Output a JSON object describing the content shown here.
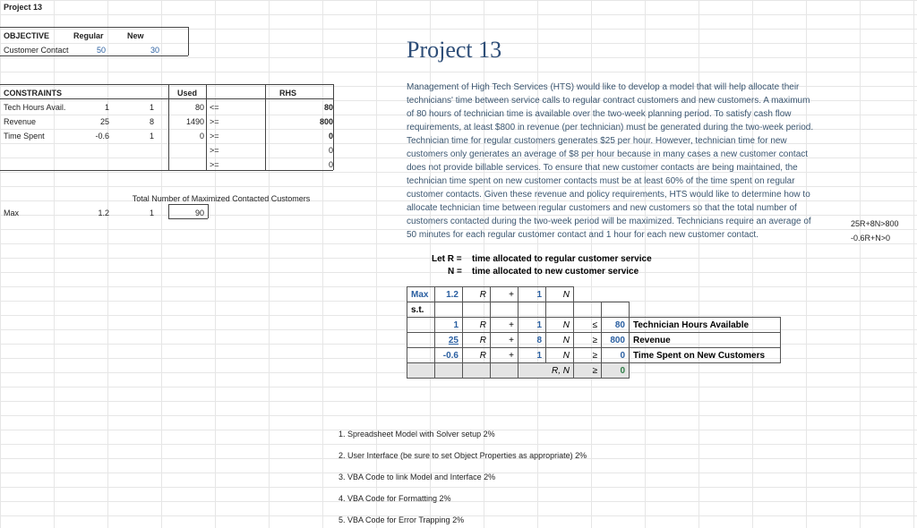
{
  "sheet_title": "Project 13",
  "objective": {
    "label": "OBJECTIVE",
    "row_label": "Customer Contact",
    "col_regular": "Regular",
    "col_new": "New",
    "regular": "50",
    "new_": "30"
  },
  "constraints": {
    "label": "CONSTRAINTS",
    "used_label": "Used",
    "rhs_label": "RHS",
    "rows": [
      {
        "name": "Tech Hours Avail.",
        "c1": "1",
        "c2": "1",
        "used": "80",
        "op": "<=",
        "rhs": "80"
      },
      {
        "name": "Revenue",
        "c1": "25",
        "c2": "8",
        "used": "1490",
        "op": ">=",
        "rhs": "800"
      },
      {
        "name": "Time Spent",
        "c1": "-0.6",
        "c2": "1",
        "used": "0",
        "op": ">=",
        "rhs": "0"
      },
      {
        "name": "",
        "c1": "",
        "c2": "",
        "used": "",
        "op": ">=",
        "rhs": "0"
      },
      {
        "name": "",
        "c1": "",
        "c2": "",
        "used": "",
        "op": ">=",
        "rhs": "0"
      }
    ],
    "total_label": "Total Number of Maximized Contacted Customers",
    "max_label": "Max",
    "max_c1": "1.2",
    "max_c2": "1",
    "max_total": "90"
  },
  "problem": {
    "title": "Project 13",
    "text": "Management of High Tech Services (HTS) would like to develop a model that will help allocate their technicians' time between service calls to regular contract customers and new customers. A maximum of 80 hours of technician time is available over the two-week planning period. To satisfy cash flow requirements, at least $800 in revenue (per technician) must be generated during the two-week period. Technician time for regular customers generates $25 per hour. However, technician time for new customers only generates an average of $8 per hour because in many cases a new customer contact does not provide billable services. To ensure that new customer contacts are being maintained, the technician time spent on new customer contacts must be at least 60% of the time spent on regular customer contacts. Given these revenue and policy requirements, HTS would like to determine how to allocate technician time between regular customers and new customers so that the total number of customers contacted during the two-week period will be maximized. Technicians require an average of 50 minutes for each regular customer contact and 1 hour for each new customer contact.",
    "side_note1": "25R+8N>800",
    "side_note2": "-0.6R+N>0",
    "let_label": "Let R =",
    "let_r": "time allocated to regular customer service",
    "n_eq": "N =",
    "let_n": "time allocated to new customer service"
  },
  "lp": {
    "max_label": "Max",
    "st_label": "s.t.",
    "obj": {
      "a": "1.2",
      "av": "R",
      "plus": "+",
      "b": "1",
      "bv": "N"
    },
    "rows": [
      {
        "a": "1",
        "av": "R",
        "plus": "+",
        "b": "1",
        "bv": "N",
        "op": "≤",
        "rhs": "80",
        "desc": "Technician Hours Available"
      },
      {
        "a": "25",
        "av": "R",
        "plus": "+",
        "b": "8",
        "bv": "N",
        "op": "≥",
        "rhs": "800",
        "desc": "Revenue"
      },
      {
        "a": "-0.6",
        "av": "R",
        "plus": "+",
        "b": "1",
        "bv": "N",
        "op": "≥",
        "rhs": "0",
        "desc": "Time Spent on New Customers"
      }
    ],
    "nonneg": {
      "vars": "R, N",
      "op": "≥",
      "rhs": "0"
    }
  },
  "deliverables": [
    "1. Spreadsheet Model with Solver setup 2%",
    "2. User Interface (be sure to set Object Properties as appropriate)  2%",
    "3. VBA Code to link Model and Interface  2%",
    "4. VBA Code for Formatting  2%",
    "5. VBA Code for Error Trapping  2%"
  ]
}
